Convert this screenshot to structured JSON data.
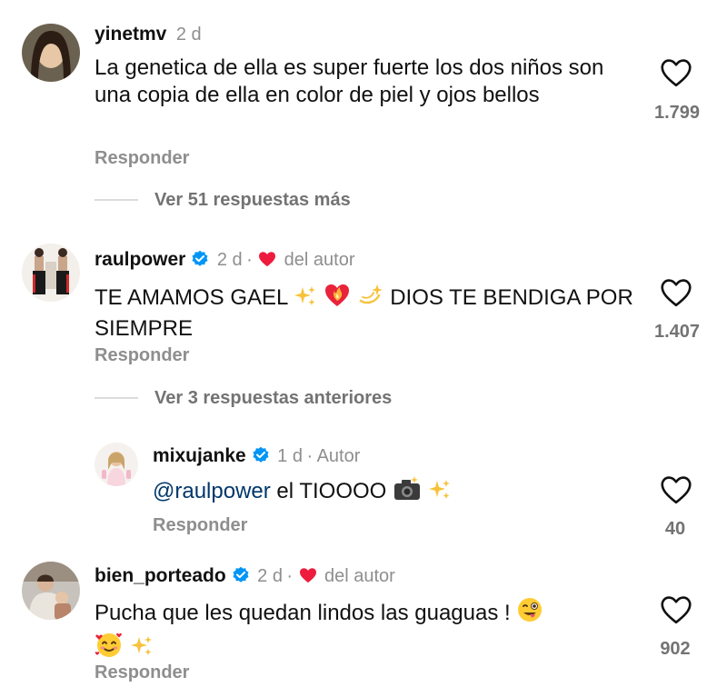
{
  "comments": [
    {
      "username": "yinetmv",
      "time": "2 d",
      "text": "La genetica de ella es super fuerte los dos niños son una copia de ella en color de piel y ojos bellos",
      "reply_label": "Responder",
      "likes": "1.799",
      "view_replies": "Ver 51 respuestas más"
    },
    {
      "username": "raulpower",
      "time": "2 d",
      "separator": "·",
      "liked_by_author": "del autor",
      "text_part1": "TE AMAMOS GAEL ",
      "text_part2": " DIOS TE BENDIGA POR SIEMPRE",
      "reply_label": "Responder",
      "likes": "1.407",
      "view_replies": "Ver 3 respuestas anteriores"
    },
    {
      "username": "mixujanke",
      "time": "1 d",
      "separator": "·",
      "author_label": "Autor",
      "mention": "@raulpower",
      "text": " el TIOOOO ",
      "reply_label": "Responder",
      "likes": "40"
    },
    {
      "username": "bien_porteado",
      "time": "2 d",
      "separator": "·",
      "liked_by_author": "del autor",
      "text": "Pucha que les quedan lindos las guaguas ! ",
      "reply_label": "Responder",
      "likes": "902"
    }
  ],
  "colors": {
    "text": "#111111",
    "meta": "#8e8e8e",
    "mention": "#00376b",
    "verified": "#0095f6",
    "heart": "#ed1c3d"
  },
  "icons": [
    "heart-outline-icon",
    "verified-badge-icon",
    "red-heart-icon",
    "sparkles-emoji",
    "heart-on-fire-emoji",
    "dizzy-emoji",
    "camera-flash-emoji",
    "winking-tongue-emoji",
    "smiling-hearts-emoji"
  ]
}
